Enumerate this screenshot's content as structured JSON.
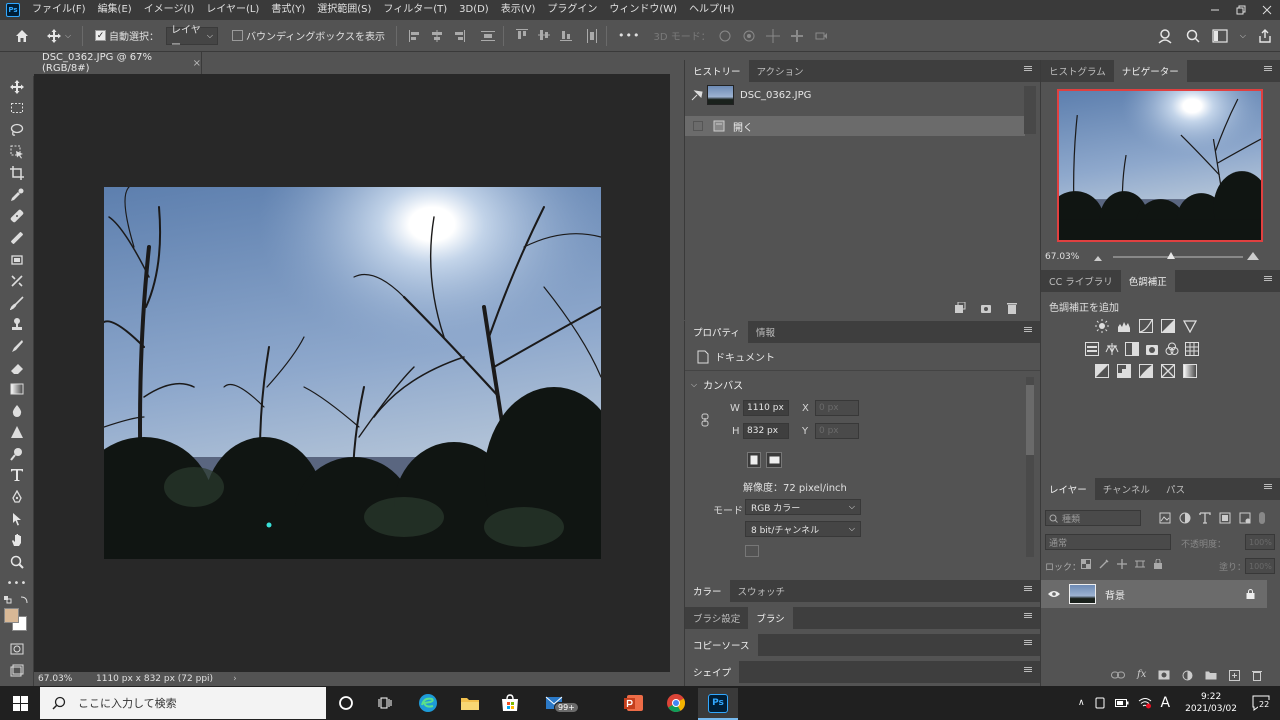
{
  "app": {
    "logo": "Ps"
  },
  "menu": [
    "ファイル(F)",
    "編集(E)",
    "イメージ(I)",
    "レイヤー(L)",
    "書式(Y)",
    "選択範囲(S)",
    "フィルター(T)",
    "3D(D)",
    "表示(V)",
    "プラグイン",
    "ウィンドウ(W)",
    "ヘルプ(H)"
  ],
  "options": {
    "auto_select_label": "自動選択：",
    "auto_select_value": "レイヤー",
    "bounding_box_label": "バウンディングボックスを表示",
    "more": "•••",
    "mode_3d": "3D モード："
  },
  "document": {
    "tab_title": "DSC_0362.JPG @ 67% (RGB/8#)",
    "zoom": "67.03%",
    "status_info": "1110 px x 832 px (72 ppi)"
  },
  "history": {
    "tabs": [
      "ヒストリー",
      "アクション"
    ],
    "snapshot": "DSC_0362.JPG",
    "steps": [
      "開く"
    ]
  },
  "properties": {
    "tabs": [
      "プロパティ",
      "情報"
    ],
    "doc_label": "ドキュメント",
    "canvas_label": "カンバス",
    "w_label": "W",
    "w_value": "1110 px",
    "x_label": "X",
    "x_value": "0 px",
    "h_label": "H",
    "h_value": "832 px",
    "y_label": "Y",
    "y_value": "0 px",
    "resolution": "解像度：72 pixel/inch",
    "mode_label": "モード",
    "mode_value": "RGB カラー",
    "depth_value": "8 bit/チャンネル"
  },
  "lower_tabs": {
    "color": [
      "カラー",
      "スウォッチ"
    ],
    "brush": [
      "ブラシ設定",
      "ブラシ"
    ],
    "clone": [
      "コピーソース"
    ],
    "shape": [
      "シェイプ"
    ]
  },
  "navigator": {
    "tabs": [
      "ヒストグラム",
      "ナビゲーター"
    ],
    "zoom": "67.03%"
  },
  "adjustments": {
    "tabs": [
      "CC ライブラリ",
      "色調補正"
    ],
    "add_label": "色調補正を追加"
  },
  "layers": {
    "tabs": [
      "レイヤー",
      "チャンネル",
      "パス"
    ],
    "filter_placeholder": "種類",
    "blend_mode": "通常",
    "opacity_label": "不透明度：",
    "opacity_value": "100%",
    "lock_label": "ロック：",
    "fill_label": "塗り：",
    "fill_value": "100%",
    "layer_name": "背景"
  },
  "taskbar": {
    "search_placeholder": "ここに入力して検索",
    "badge": "99+",
    "ime": "A",
    "time": "9:22",
    "date": "2021/03/02",
    "notifications": "22"
  },
  "colors": {
    "accent": "#31a8ff",
    "fg": "#d8b896",
    "bg": "#ffffff",
    "nav_frame": "#e04040"
  }
}
